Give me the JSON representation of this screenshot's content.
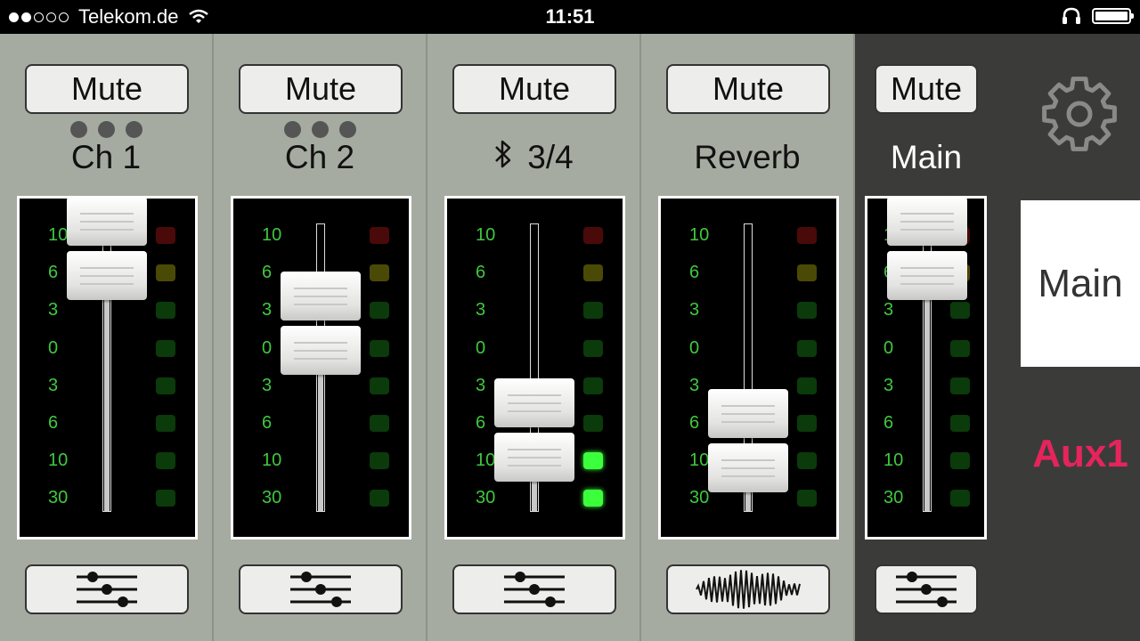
{
  "status": {
    "signal_full": 2,
    "signal_empty": 3,
    "carrier": "Telekom.de",
    "time": "11:51"
  },
  "scale_labels": [
    "10",
    "6",
    "3",
    "0",
    "3",
    "6",
    "10",
    "30"
  ],
  "led_colors": {
    "red_dim": "#4a0a0a",
    "yellow_dim": "#4a4a06",
    "green_dim": "#0b3a0b",
    "green_lit": "#3cff3c"
  },
  "channels": [
    {
      "id": "ch1",
      "mute_label": "Mute",
      "name": "Ch 1",
      "has_link_dots": true,
      "fader_level": 0.0,
      "footer_icon": "sliders-icon"
    },
    {
      "id": "ch2",
      "mute_label": "Mute",
      "name": "Ch 2",
      "has_link_dots": true,
      "fader_level": 0.35,
      "footer_icon": "sliders-icon"
    },
    {
      "id": "ch34",
      "mute_label": "Mute",
      "name": "3/4",
      "name_icon": "bluetooth-icon",
      "has_link_dots": false,
      "fader_level": 0.85,
      "lit_leds": [
        6,
        7
      ],
      "footer_icon": "sliders-icon"
    },
    {
      "id": "reverb",
      "mute_label": "Mute",
      "name": "Reverb",
      "has_link_dots": false,
      "fader_level": 0.9,
      "footer_icon": "waveform-icon"
    },
    {
      "id": "main",
      "mute_label": "Mute",
      "name": "Main",
      "has_link_dots": false,
      "fader_level": 0.0,
      "footer_icon": "sliders-icon"
    }
  ],
  "tabs": {
    "main_label": "Main",
    "aux_label": "Aux1",
    "aux_color": "#e6245c"
  },
  "icons": {
    "settings": "gear-icon",
    "headphones": "headphones-icon",
    "wifi": "wifi-icon",
    "battery": "battery-icon"
  }
}
